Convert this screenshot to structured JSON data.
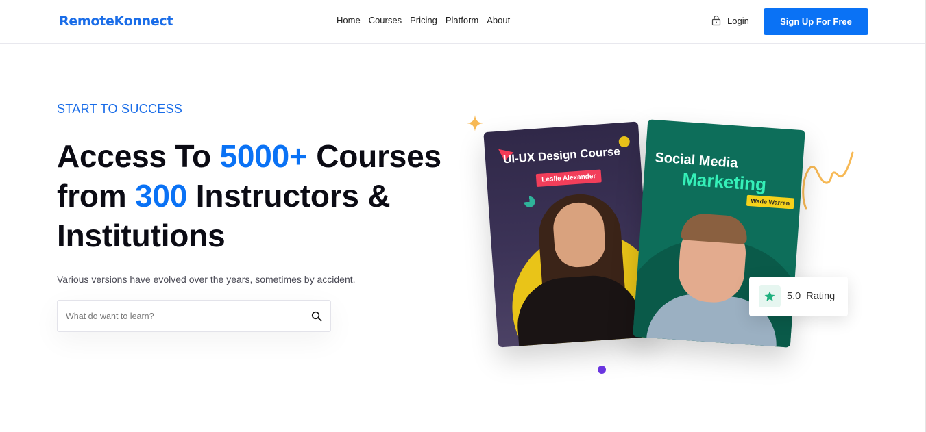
{
  "brand": {
    "logo_text": "RemoteKonnect",
    "accent_color": "#0a72f5"
  },
  "nav": {
    "items": [
      "Home",
      "Courses",
      "Pricing",
      "Platform",
      "About"
    ]
  },
  "auth": {
    "login_label": "Login",
    "signup_label": "Sign Up For Free",
    "login_icon": "lock-icon"
  },
  "hero": {
    "eyebrow": "START TO SUCCESS",
    "headline": {
      "part1": "Access To ",
      "highlight1": "5000+",
      "part2": " Courses from ",
      "highlight2": "300",
      "part3": " Instructors & Institutions"
    },
    "subtitle": "Various versions have evolved over the years, sometimes by accident.",
    "search": {
      "placeholder": "What do want to learn?",
      "value": "",
      "icon": "search-icon"
    }
  },
  "cards": [
    {
      "title": "UI-UX Design Course",
      "instructor": "Leslie Alexander",
      "bg_color": "#302848",
      "tag_color": "#f23e5a"
    },
    {
      "title_line1": "Social Media",
      "title_line2": "Marketing",
      "instructor": "Wade Warren",
      "bg_color": "#0d6e5a",
      "tag_color": "#f6d21b"
    }
  ],
  "rating": {
    "value": "5.0",
    "label": "Rating",
    "icon": "star-icon"
  },
  "carousel": {
    "active_dot_color": "#6a35e0"
  }
}
